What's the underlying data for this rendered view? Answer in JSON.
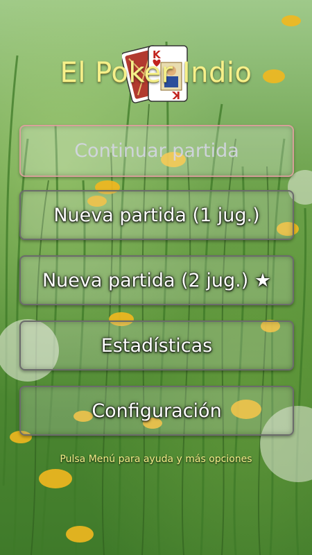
{
  "app": {
    "title": "El Poker Indio"
  },
  "menu": {
    "continue": "Continuar partida",
    "new_game_1p": "Nueva partida (1 jug.)",
    "new_game_2p": "Nueva partida (2 jug.) ★",
    "stats": "Estadísticas",
    "settings": "Configuración"
  },
  "footer": {
    "hint": "Pulsa Menú para ayuda y más opciones"
  },
  "cards": {
    "back_card_rank": "K",
    "front_card_rank": "K"
  },
  "colors": {
    "title": "#f6f08a",
    "button_text": "#ffffff",
    "disabled_border": "#e0a0a0"
  }
}
